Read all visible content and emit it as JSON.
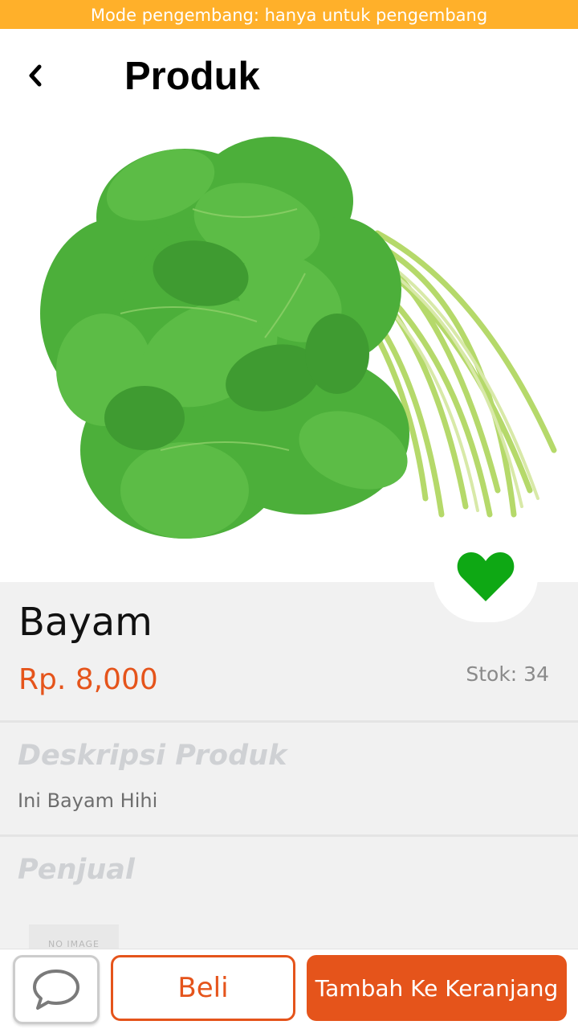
{
  "dev_banner": "Mode pengembang: hanya untuk pengembang",
  "header": {
    "back_icon": "chevron-left-icon",
    "title": "Produk"
  },
  "product": {
    "image": "spinach-bunch-photo",
    "favorite_icon": "heart-icon",
    "favorite_color": "#0ea814",
    "name": "Bayam",
    "price": "Rp. 8,000",
    "stock": "Stok: 34"
  },
  "description": {
    "title": "Deskripsi Produk",
    "text": "Ini Bayam Hihi"
  },
  "seller": {
    "title": "Penjual",
    "thumbnail_text": "NO IMAGE AVAILABLE"
  },
  "actions": {
    "chat_icon": "chat-bubble-icon",
    "buy_label": "Beli",
    "add_to_cart_label": "Tambah Ke Keranjang"
  },
  "colors": {
    "accent": "#e5541b",
    "banner": "#ffb02a"
  }
}
